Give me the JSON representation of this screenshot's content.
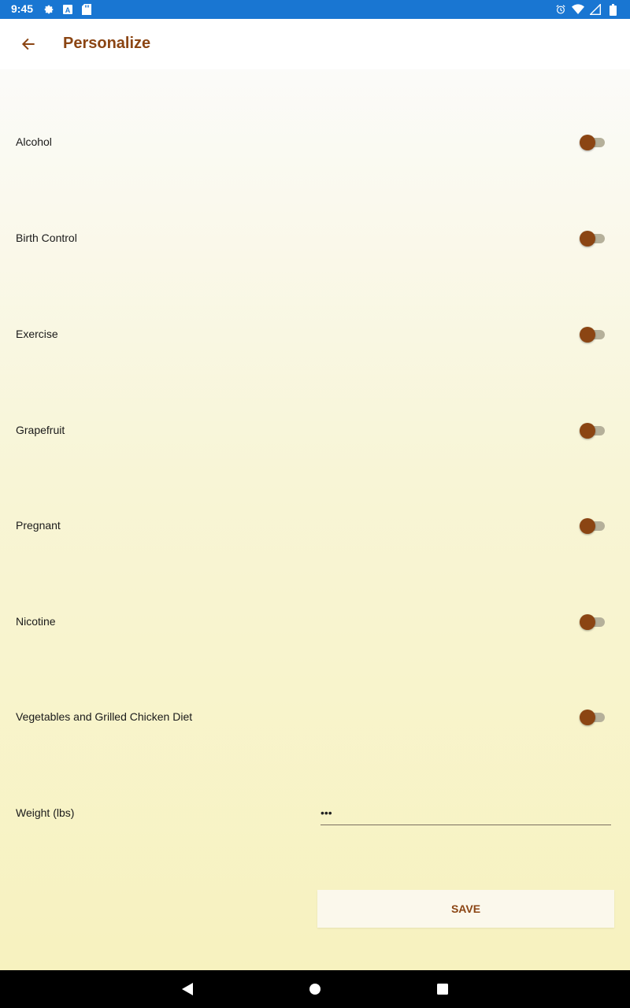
{
  "status_bar": {
    "time": "9:45",
    "left_icons": [
      "settings-icon",
      "a-badge-icon",
      "sd-card-icon"
    ],
    "right_icons": [
      "alarm-icon",
      "wifi-icon",
      "signal-icon",
      "battery-icon"
    ],
    "background": "#1976d2"
  },
  "app_bar": {
    "back_icon": "arrow-back-icon",
    "title": "Personalize",
    "title_color": "#8b4513"
  },
  "settings": [
    {
      "label": "Alcohol",
      "enabled": false
    },
    {
      "label": "Birth Control",
      "enabled": false
    },
    {
      "label": "Exercise",
      "enabled": false
    },
    {
      "label": "Grapefruit",
      "enabled": false
    },
    {
      "label": "Pregnant",
      "enabled": false
    },
    {
      "label": "Nicotine",
      "enabled": false
    },
    {
      "label": "Vegetables and Grilled Chicken Diet",
      "enabled": false
    }
  ],
  "weight": {
    "label": "Weight (lbs)",
    "value": "•••"
  },
  "save_button": {
    "label": "SAVE"
  },
  "nav_bar": {
    "icons": [
      "back-triangle-icon",
      "home-circle-icon",
      "recents-square-icon"
    ]
  },
  "colors": {
    "accent": "#8b4513",
    "switch_track": "#b5b09a",
    "gradient_top": "#fbfbf9",
    "gradient_bottom": "#f7f2bf"
  }
}
